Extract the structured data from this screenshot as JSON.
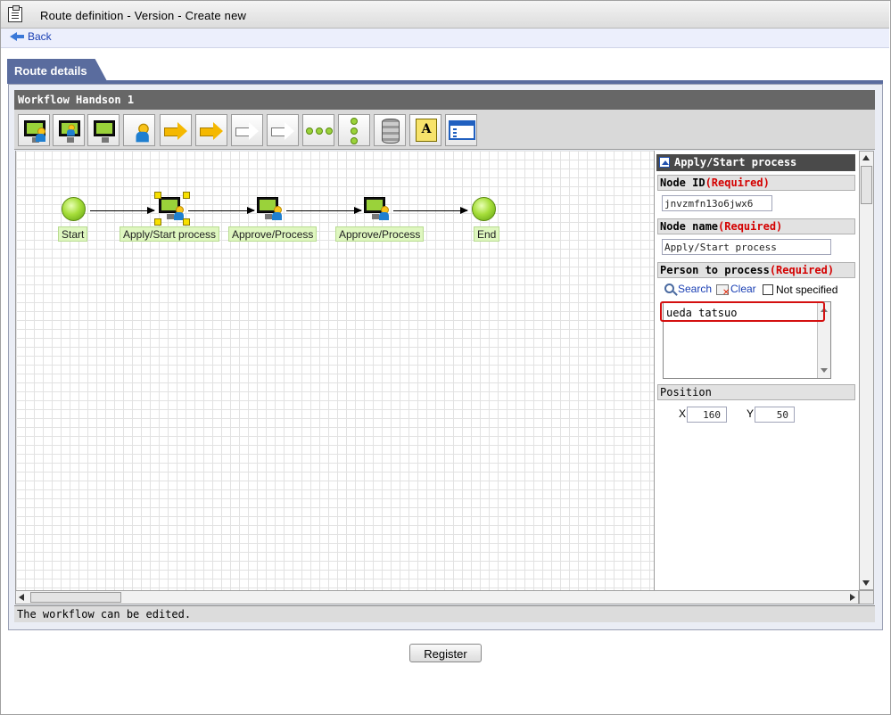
{
  "window": {
    "title": "Route definition - Version - Create new"
  },
  "nav": {
    "back_label": "Back"
  },
  "tab": {
    "label": "Route details"
  },
  "workflow": {
    "name": "Workflow Handson 1",
    "status": "The workflow can be edited."
  },
  "toolbar": {
    "tools": [
      {
        "icon": "monitor-person-icon"
      },
      {
        "icon": "monitor-person-alt-icon"
      },
      {
        "icon": "monitor-icon"
      },
      {
        "icon": "person-icon"
      },
      {
        "icon": "branch-arrow-icon"
      },
      {
        "icon": "merge-arrow-icon"
      },
      {
        "icon": "branch-arrow-grey-icon"
      },
      {
        "icon": "merge-arrow-grey-icon"
      },
      {
        "icon": "horizontal-nodes-icon"
      },
      {
        "icon": "vertical-nodes-icon"
      },
      {
        "icon": "database-icon"
      },
      {
        "icon": "text-annotation-icon"
      },
      {
        "icon": "window-icon"
      }
    ]
  },
  "diagram": {
    "nodes": [
      {
        "label": "Start",
        "kind": "start"
      },
      {
        "label": "Apply/Start process",
        "kind": "task",
        "selected": true
      },
      {
        "label": "Approve/Process",
        "kind": "task"
      },
      {
        "label": "Approve/Process",
        "kind": "task"
      },
      {
        "label": "End",
        "kind": "end"
      }
    ]
  },
  "panel": {
    "title": "Apply/Start process",
    "node_id": {
      "label": "Node ID",
      "required": "(Required)",
      "value": "jnvzmfn13o6jwx6"
    },
    "node_name": {
      "label": "Node name",
      "required": "(Required)",
      "value": "Apply/Start process"
    },
    "person": {
      "label": "Person to process",
      "required": "(Required)",
      "search_label": "Search",
      "clear_label": "Clear",
      "not_specified_label": "Not specified",
      "not_specified_checked": false,
      "selected": "ueda tatsuo"
    },
    "position": {
      "label": "Position",
      "x_label": "X",
      "x_value": "160",
      "y_label": "Y",
      "y_value": "50"
    }
  },
  "actions": {
    "register_label": "Register"
  },
  "colors": {
    "accent": "#5a6c9e",
    "required": "#d40000",
    "node_green": "#a6de3a",
    "label_green": "#dff7c0",
    "highlight": "#d41010"
  }
}
